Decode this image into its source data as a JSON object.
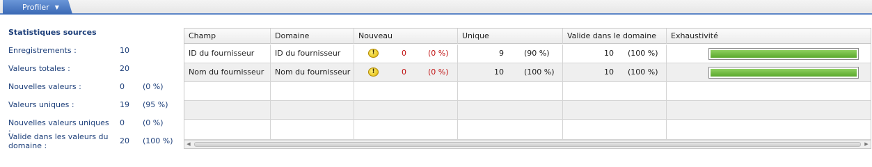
{
  "tab": {
    "label": "Profiler"
  },
  "stats": {
    "title": "Statistiques sources",
    "rows": [
      {
        "label": "Enregistrements :",
        "value": "10",
        "pct": ""
      },
      {
        "label": "Valeurs totales :",
        "value": "20",
        "pct": ""
      },
      {
        "label": "Nouvelles valeurs :",
        "value": "0",
        "pct": "(0 %)"
      },
      {
        "label": "Valeurs uniques :",
        "value": "19",
        "pct": "(95 %)"
      },
      {
        "label": "Nouvelles valeurs uniques :",
        "value": "0",
        "pct": "(0 %)"
      },
      {
        "label": "Valide dans les valeurs du domaine :",
        "value": "20",
        "pct": "(100 %)"
      }
    ]
  },
  "grid": {
    "headers": [
      "Champ",
      "Domaine",
      "Nouveau",
      "Unique",
      "Valide dans le domaine",
      "Exhaustivité"
    ],
    "rows": [
      {
        "champ": "ID du fournisseur",
        "domaine": "ID du fournisseur",
        "nouveau": "0",
        "nouveau_pct": "(0 %)",
        "unique": "9",
        "unique_pct": "(90 %)",
        "valide": "10",
        "valide_pct": "(100 %)",
        "exhaustivite": 1.0
      },
      {
        "champ": "Nom du fournisseur",
        "domaine": "Nom du fournisseur",
        "nouveau": "0",
        "nouveau_pct": "(0 %)",
        "unique": "10",
        "unique_pct": "(100 %)",
        "valide": "10",
        "valide_pct": "(100 %)",
        "exhaustivite": 1.0
      }
    ]
  },
  "icons": {
    "tab_caret": "caret-down-icon",
    "warning": "warning-icon"
  },
  "colors": {
    "tab": "#4a78c4",
    "stat_text": "#1d3f7a",
    "new_red": "#c01010",
    "progress_green": "#6bb83a"
  }
}
